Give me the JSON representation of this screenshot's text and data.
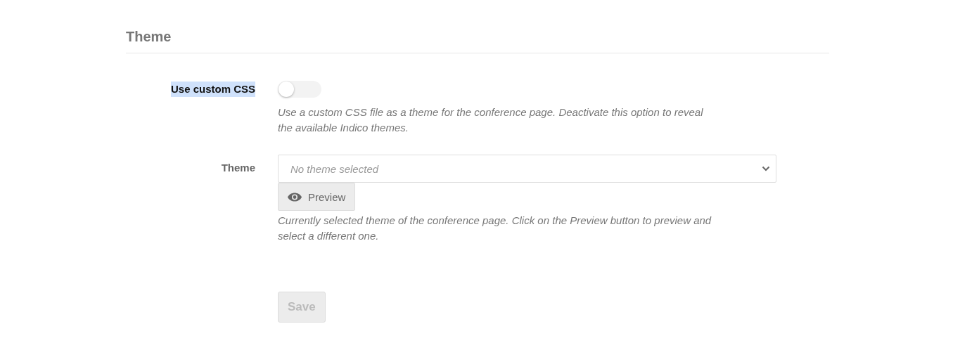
{
  "section": {
    "title": "Theme"
  },
  "fields": [
    {
      "kind": "toggle",
      "label": "Use custom CSS",
      "label_highlighted": true,
      "on": false,
      "help": "Use a custom CSS file as a theme for the conference page. Deactivate this option to reveal the available Indico themes."
    },
    {
      "kind": "select",
      "label": "Theme",
      "label_highlighted": false,
      "placeholder": "No theme selected",
      "button": "Preview",
      "help": "Currently selected theme of the conference page. Click on the Preview button to preview and select a different one."
    }
  ],
  "save_button": {
    "label": "Save",
    "disabled": true
  }
}
